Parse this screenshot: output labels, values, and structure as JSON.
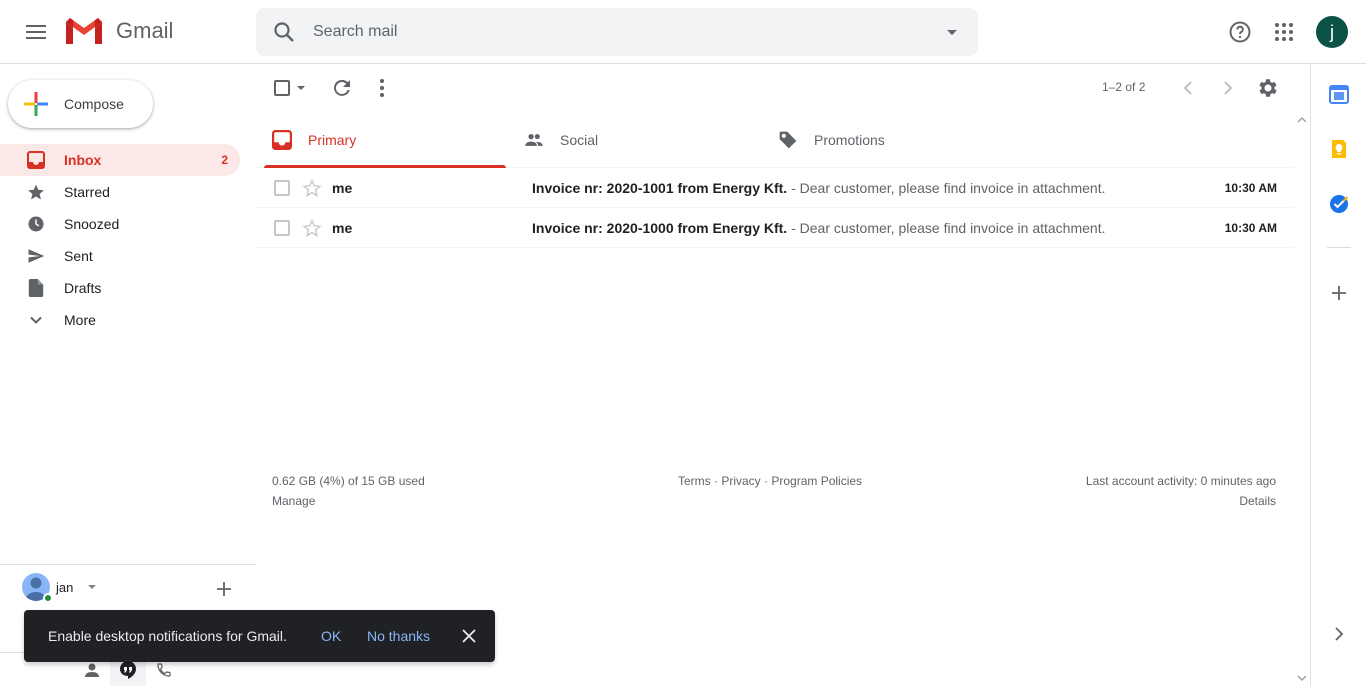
{
  "header": {
    "logo_text": "Gmail",
    "search_placeholder": "Search mail",
    "avatar_letter": "j"
  },
  "compose": {
    "label": "Compose"
  },
  "nav": {
    "items": [
      {
        "label": "Inbox",
        "count": "2",
        "icon": "inbox-icon",
        "active": true
      },
      {
        "label": "Starred",
        "count": "",
        "icon": "star-icon"
      },
      {
        "label": "Snoozed",
        "count": "",
        "icon": "clock-icon"
      },
      {
        "label": "Sent",
        "count": "",
        "icon": "send-icon"
      },
      {
        "label": "Drafts",
        "count": "",
        "icon": "draft-icon"
      },
      {
        "label": "More",
        "count": "",
        "icon": "chevron-down-icon"
      }
    ]
  },
  "hangouts": {
    "user_name": "jan"
  },
  "toolbar": {
    "range": "1–2 of 2"
  },
  "tabs": [
    {
      "label": "Primary",
      "icon": "inbox-icon"
    },
    {
      "label": "Social",
      "icon": "people-icon"
    },
    {
      "label": "Promotions",
      "icon": "tag-icon"
    }
  ],
  "emails": [
    {
      "sender": "me",
      "subject": "Invoice nr: 2020-1001 from Energy Kft.",
      "snippet": " - Dear customer, please find invoice in attachment.",
      "time": "10:30 AM"
    },
    {
      "sender": "me",
      "subject": "Invoice nr: 2020-1000 from Energy Kft.",
      "snippet": " - Dear customer, please find invoice in attachment.",
      "time": "10:30 AM"
    }
  ],
  "footer": {
    "storage": "0.62 GB (4%) of 15 GB used",
    "manage": "Manage",
    "terms": "Terms",
    "privacy": "Privacy",
    "program_policies": "Program Policies",
    "sep": " · ",
    "activity": "Last account activity: 0 minutes ago",
    "details": "Details"
  },
  "snackbar": {
    "message": "Enable desktop notifications for Gmail.",
    "ok": "OK",
    "no_thanks": "No thanks"
  },
  "colors": {
    "accent_red": "#d93025",
    "active_bg": "#fce8e6",
    "snackbar_bg": "#202124",
    "link_blue": "#8ab4f8"
  }
}
